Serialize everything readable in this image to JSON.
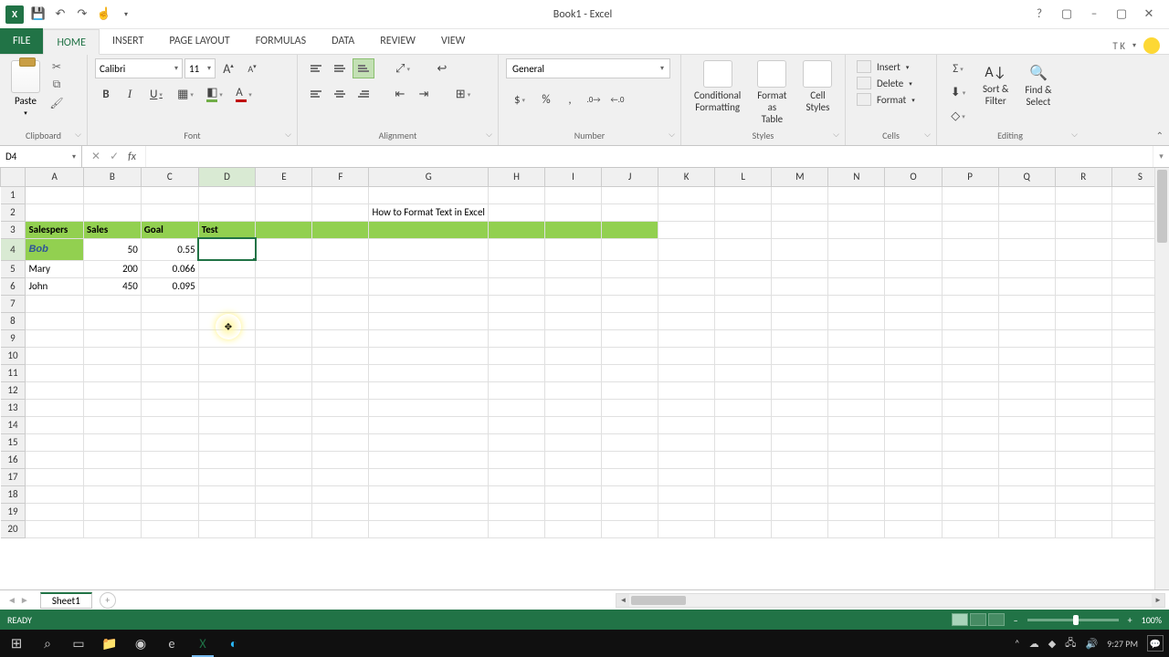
{
  "titlebar": {
    "title": "Book1 - Excel"
  },
  "tabs": {
    "file": "FILE",
    "home": "HOME",
    "insert": "INSERT",
    "page_layout": "PAGE LAYOUT",
    "formulas": "FORMULAS",
    "data": "DATA",
    "review": "REVIEW",
    "view": "VIEW",
    "user": "T K"
  },
  "ribbon": {
    "clipboard": {
      "paste": "Paste",
      "label": "Clipboard"
    },
    "font": {
      "name": "Calibri",
      "size": "11",
      "bold": "B",
      "italic": "I",
      "underline": "U",
      "grow": "A",
      "shrink": "A",
      "label": "Font"
    },
    "alignment": {
      "label": "Alignment"
    },
    "number": {
      "format": "General",
      "label": "Number",
      "dollar": "$",
      "percent": "%",
      "comma": ",",
      "inc": "←.0",
      "dec": ".00→"
    },
    "styles": {
      "cond": "Conditional\nFormatting",
      "table": "Format as\nTable",
      "cell": "Cell\nStyles",
      "label": "Styles"
    },
    "cells": {
      "insert": "Insert",
      "delete": "Delete",
      "format": "Format",
      "label": "Cells"
    },
    "editing": {
      "sum": "Σ",
      "fill": "⬇",
      "clear": "◇",
      "sort": "Sort &\nFilter",
      "find": "Find &\nSelect",
      "label": "Editing"
    }
  },
  "namebox": "D4",
  "sheet": {
    "columns": [
      "A",
      "B",
      "C",
      "D",
      "E",
      "F",
      "G",
      "H",
      "I",
      "J",
      "K",
      "L",
      "M",
      "N",
      "O",
      "P",
      "Q",
      "R",
      "S"
    ],
    "rows": [
      "1",
      "2",
      "3",
      "4",
      "5",
      "6",
      "7",
      "8",
      "9",
      "10",
      "11",
      "12",
      "13",
      "14",
      "15",
      "16",
      "17",
      "18",
      "19",
      "20"
    ],
    "selected_col": 3,
    "selected_row": 3,
    "title_cell": {
      "text": "How to Format Text in Excel",
      "row": 1,
      "col_start": 4,
      "col_span": 7
    },
    "header_row": {
      "row": 2,
      "cells": [
        "Salespers",
        "Sales",
        "Goal",
        "Test",
        "",
        "",
        "",
        "",
        "",
        ""
      ]
    },
    "data": [
      {
        "a": "Bob",
        "b": "50",
        "c": "0.55"
      },
      {
        "a": "Mary",
        "b": "200",
        "c": "0.066"
      },
      {
        "a": "John",
        "b": "450",
        "c": "0.095"
      }
    ]
  },
  "sheet_tab": "Sheet1",
  "status": {
    "ready": "READY",
    "zoom": "100%"
  },
  "taskbar": {
    "time": "9:27 PM",
    "date": ""
  }
}
